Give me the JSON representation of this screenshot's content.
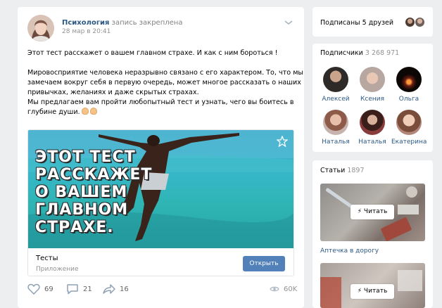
{
  "post": {
    "author": "Психология",
    "status": "запись закреплена",
    "date": "28 мар в 20:41",
    "lines": [
      "Этот тест расскажет о вашем главном страхе. И как с ним бороться !",
      "",
      "Мировосприятие человека неразрывно связано с его характером. То, что мы",
      "замечаем вокруг себя в первую очередь, может многое рассказать о наших",
      "привычках, желаниях и даже скрытых страхах.",
      "Мы предлагаем вам пройти любопытный тест и узнать, чего вы боитесь в",
      "глубине души."
    ],
    "image_text": [
      "ЭТОТ ТЕСТ",
      "РАССКАЖЕТ",
      "О ВАШЕМ",
      "ГЛАВНОМ",
      "СТРАХЕ."
    ],
    "app": {
      "name": "Тесты",
      "type": "Приложение",
      "button": "Открыть"
    },
    "likes": "69",
    "comments": "21",
    "shares": "16",
    "views": "60K"
  },
  "sidebar": {
    "friends_label": "Подписаны 5 друзей",
    "subscribers_label": "Подписчики",
    "subscribers_count": "3 268 971",
    "subscribers": [
      "Алексей",
      "Ксения",
      "Ольга",
      "Наталья",
      "Наталья",
      "Екатерина"
    ],
    "articles_label": "Статьи",
    "articles_count": "1897",
    "read_label": "Читать",
    "article_captions": [
      "Аптечка в дорогу"
    ]
  },
  "colors": {
    "link": "#2a5885",
    "button": "#5181b8",
    "background": "#edeef0"
  }
}
